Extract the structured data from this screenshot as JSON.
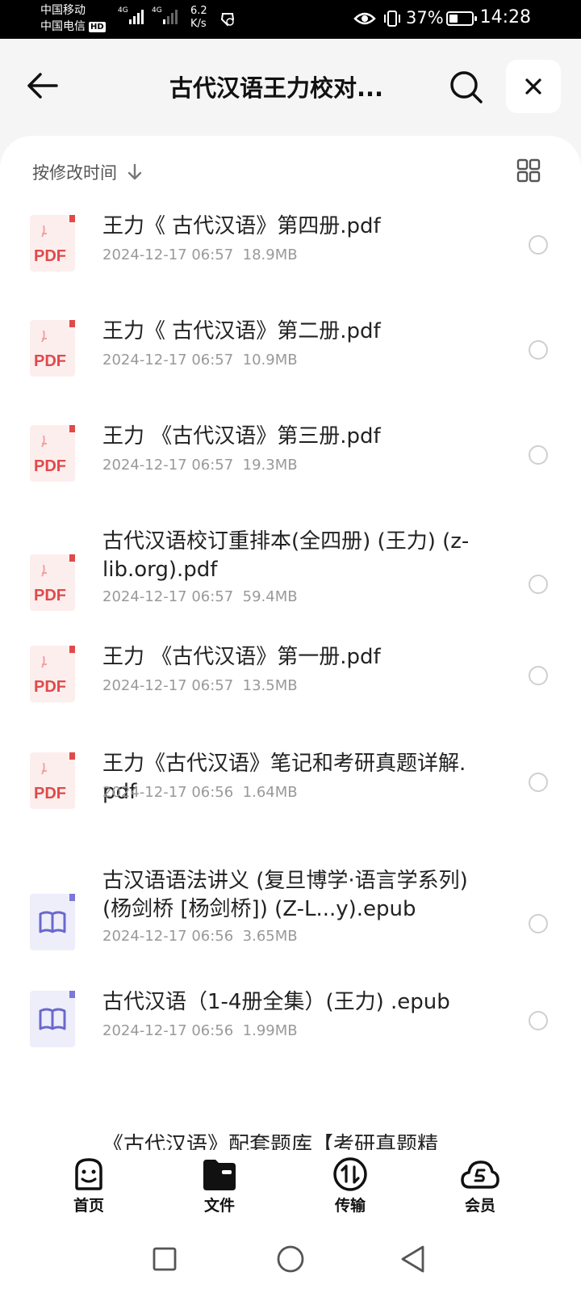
{
  "status_bar": {
    "carrier1": "中国移动",
    "carrier2": "中国电信",
    "hd_badge": "HD",
    "net1": "4G",
    "net2": "4G",
    "speed_value": "6.2",
    "speed_unit": "K/s",
    "battery": "37%",
    "battery_level": 0.37,
    "time": "14:28"
  },
  "header": {
    "title": "古代汉语王力校对..."
  },
  "sort": {
    "label": "按修改时间"
  },
  "files": [
    {
      "name": "王力《 古代汉语》第四册.pdf",
      "date": "2024-12-17 06:57",
      "size": "18.9MB",
      "type": "pdf",
      "type_label": "PDF"
    },
    {
      "name": "王力《 古代汉语》第二册.pdf",
      "date": "2024-12-17 06:57",
      "size": "10.9MB",
      "type": "pdf",
      "type_label": "PDF"
    },
    {
      "name": "王力 《古代汉语》第三册.pdf",
      "date": "2024-12-17 06:57",
      "size": "19.3MB",
      "type": "pdf",
      "type_label": "PDF"
    },
    {
      "name": "古代汉语校订重排本(全四册) (王力) (z-lib.org).pdf",
      "date": "2024-12-17 06:57",
      "size": "59.4MB",
      "type": "pdf",
      "type_label": "PDF"
    },
    {
      "name": "王力 《古代汉语》第一册.pdf",
      "date": "2024-12-17 06:57",
      "size": "13.5MB",
      "type": "pdf",
      "type_label": "PDF"
    },
    {
      "name": "王力《古代汉语》笔记和考研真题详解.pdf",
      "date": "2024-12-17 06:56",
      "size": "1.64MB",
      "type": "pdf",
      "type_label": "PDF"
    },
    {
      "name": "古汉语语法讲义 (复旦博学·语言学系列) (杨剑桥 [杨剑桥]) (Z-L...y).epub",
      "date": "2024-12-17 06:56",
      "size": "3.65MB",
      "type": "epub",
      "type_label": ""
    },
    {
      "name": "古代汉语（1-4册全集）(王力) .epub",
      "date": "2024-12-17 06:56",
      "size": "1.99MB",
      "type": "epub",
      "type_label": ""
    }
  ],
  "partial_item": "《古代汉语》配套题库【考研真题精",
  "nav": {
    "home": "首页",
    "files": "文件",
    "transfer": "传输",
    "vip": "会员"
  }
}
